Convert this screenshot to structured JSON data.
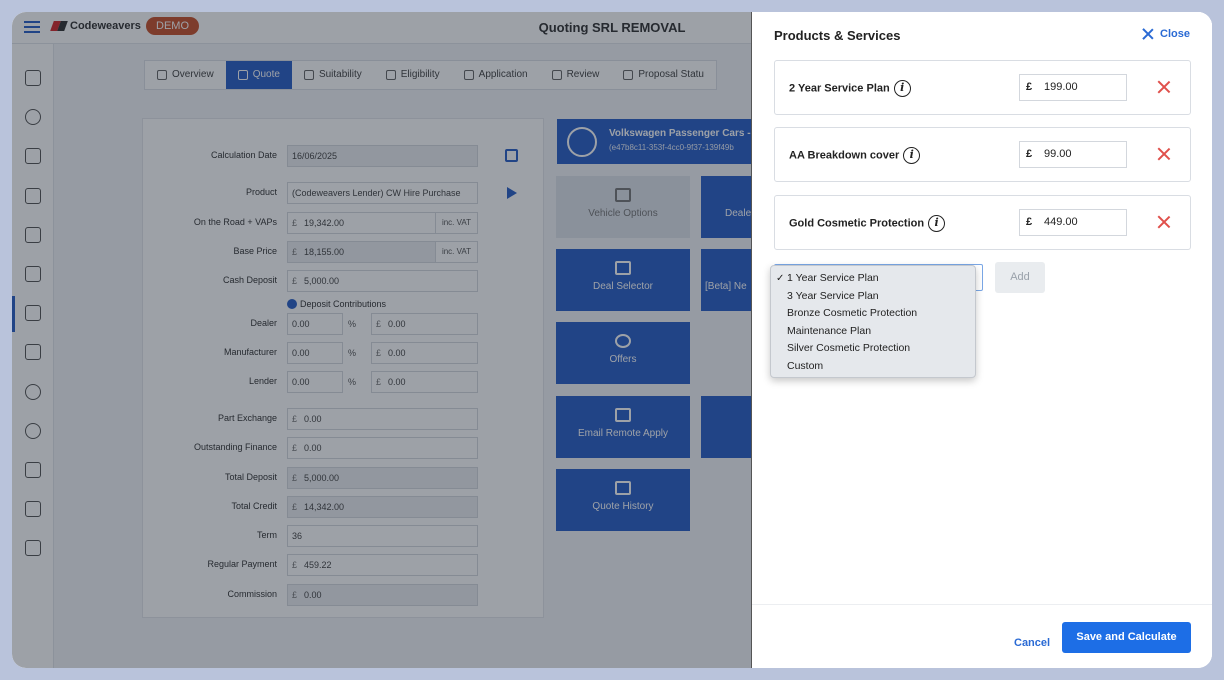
{
  "app": {
    "brand": "Codeweavers",
    "demo_badge": "DEMO",
    "title": "Quoting SRL REMOVAL",
    "tabs": [
      {
        "label": "Overview",
        "icon": "overview-icon"
      },
      {
        "label": "Quote",
        "icon": "quote-icon",
        "active": true
      },
      {
        "label": "Suitability",
        "icon": "suitability-icon"
      },
      {
        "label": "Eligibility",
        "icon": "eligibility-icon"
      },
      {
        "label": "Application",
        "icon": "application-icon"
      },
      {
        "label": "Review",
        "icon": "review-icon"
      },
      {
        "label": "Proposal Statu",
        "icon": "proposal-icon"
      }
    ],
    "form": {
      "calculation_date": {
        "label": "Calculation Date",
        "value": "16/06/2025"
      },
      "product": {
        "label": "Product",
        "value": "(Codeweavers Lender) CW Hire Purchase"
      },
      "on_the_road": {
        "label": "On the Road + VAPs",
        "currency": "£",
        "value": "19,342.00",
        "suffix": "inc. VAT"
      },
      "base_price": {
        "label": "Base Price",
        "currency": "£",
        "value": "18,155.00",
        "suffix": "inc. VAT"
      },
      "cash_deposit": {
        "label": "Cash Deposit",
        "currency": "£",
        "value": "5,000.00"
      },
      "deposit_contributions": "Deposit Contributions",
      "dealer": {
        "label": "Dealer",
        "pct": "0.00",
        "pct_sign": "%",
        "currency": "£",
        "amount": "0.00"
      },
      "manufacturer": {
        "label": "Manufacturer",
        "pct": "0.00",
        "pct_sign": "%",
        "currency": "£",
        "amount": "0.00"
      },
      "lender": {
        "label": "Lender",
        "pct": "0.00",
        "pct_sign": "%",
        "currency": "£",
        "amount": "0.00"
      },
      "part_exchange": {
        "label": "Part Exchange",
        "currency": "£",
        "value": "0.00"
      },
      "outstanding_finance": {
        "label": "Outstanding Finance",
        "currency": "£",
        "value": "0.00"
      },
      "total_deposit": {
        "label": "Total Deposit",
        "currency": "£",
        "value": "5,000.00"
      },
      "total_credit": {
        "label": "Total Credit",
        "currency": "£",
        "value": "14,342.00"
      },
      "term": {
        "label": "Term",
        "value": "36"
      },
      "regular_payment": {
        "label": "Regular Payment",
        "currency": "£",
        "value": "459.22"
      },
      "commission": {
        "label": "Commission",
        "currency": "£",
        "value": "0.00"
      }
    },
    "vehicle": {
      "title": "Volkswagen Passenger Cars -",
      "id": "(e47b8c11-353f-4cc0-9f37-139f49b"
    },
    "tiles": [
      {
        "label": "Vehicle Options",
        "icon": "list-icon"
      },
      {
        "label": "Deale",
        "icon": "dealer-icon"
      },
      {
        "label": "Deal Selector",
        "icon": "bar-chart-icon"
      },
      {
        "label": "[Beta] Ne",
        "icon": "beta-icon"
      },
      {
        "label": "Offers",
        "icon": "star-icon"
      },
      {
        "label": "Email Remote Apply",
        "icon": "envelope-icon"
      },
      {
        "label": "Quote History",
        "icon": "sort-icon"
      }
    ]
  },
  "drawer": {
    "title": "Products & Services",
    "close_label": "Close",
    "products": [
      {
        "name": "2 Year Service Plan",
        "currency": "£",
        "price": "199.00"
      },
      {
        "name": "AA Breakdown cover",
        "currency": "£",
        "price": "99.00"
      },
      {
        "name": "Gold Cosmetic Protection",
        "currency": "£",
        "price": "449.00"
      }
    ],
    "select": {
      "options": [
        "1 Year Service Plan",
        "3 Year Service Plan",
        "Bronze Cosmetic Protection",
        "Maintenance Plan",
        "Silver Cosmetic Protection",
        "Custom"
      ],
      "selected": "1 Year Service Plan"
    },
    "add_label": "Add",
    "cancel_label": "Cancel",
    "save_label": "Save and Calculate"
  }
}
